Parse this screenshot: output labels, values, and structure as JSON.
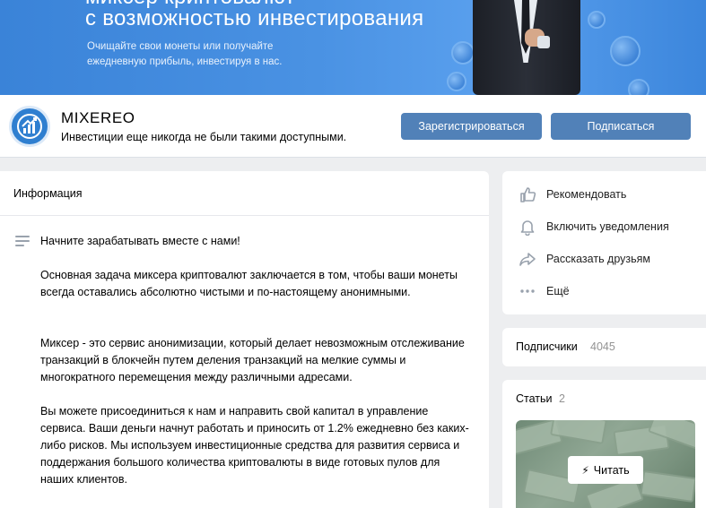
{
  "banner": {
    "title_line1": "миксер криптовалют",
    "title_line2": "с возможностью инвестирования",
    "sub_line1": "Очищайте свои монеты или получайте",
    "sub_line2": "ежедневную прибыль,  инвестируя в нас."
  },
  "header": {
    "name": "MIXEREO",
    "status": "Инвестиции еще никогда не были такими доступными.",
    "register_label": "Зарегистрироваться",
    "subscribe_label": "Подписаться"
  },
  "info": {
    "title": "Информация",
    "paragraphs": [
      "Начните зарабатывать вместе с нами!",
      "Основная задача миксера криптовалют заключается в том, чтобы ваши монеты всегда оставались абсолютно чистыми и по-настоящему анонимными.",
      "Миксер - это сервис анонимизации, который делает невозможным отслеживание транзакций в блокчейн путем деления транзакций на мелкие суммы и многократного перемещения между различными адресами.",
      "Вы можете присоединиться к нам и направить свой капитал в управление сервиса. Ваши деньги начнут работать и приносить от 1.2% ежедневно без каких-либо рисков. Мы используем инвестиционные средства для развития сервиса и поддержания большого количества криптовалюты в виде готовых пулов для наших клиентов."
    ]
  },
  "actions": [
    {
      "label": "Рекомендовать",
      "icon": "thumbs-up-icon"
    },
    {
      "label": "Включить уведомления",
      "icon": "bell-icon"
    },
    {
      "label": "Рассказать друзьям",
      "icon": "share-arrow-icon"
    },
    {
      "label": "Ещё",
      "icon": "more-dots-icon"
    }
  ],
  "subscribers": {
    "title": "Подписчики",
    "count": "4045"
  },
  "articles": {
    "title": "Статьи",
    "count": "2",
    "read_label": "Читать"
  },
  "colors": {
    "accent": "#5181b8",
    "banner": "#4a92e3",
    "background": "#edeef0"
  }
}
